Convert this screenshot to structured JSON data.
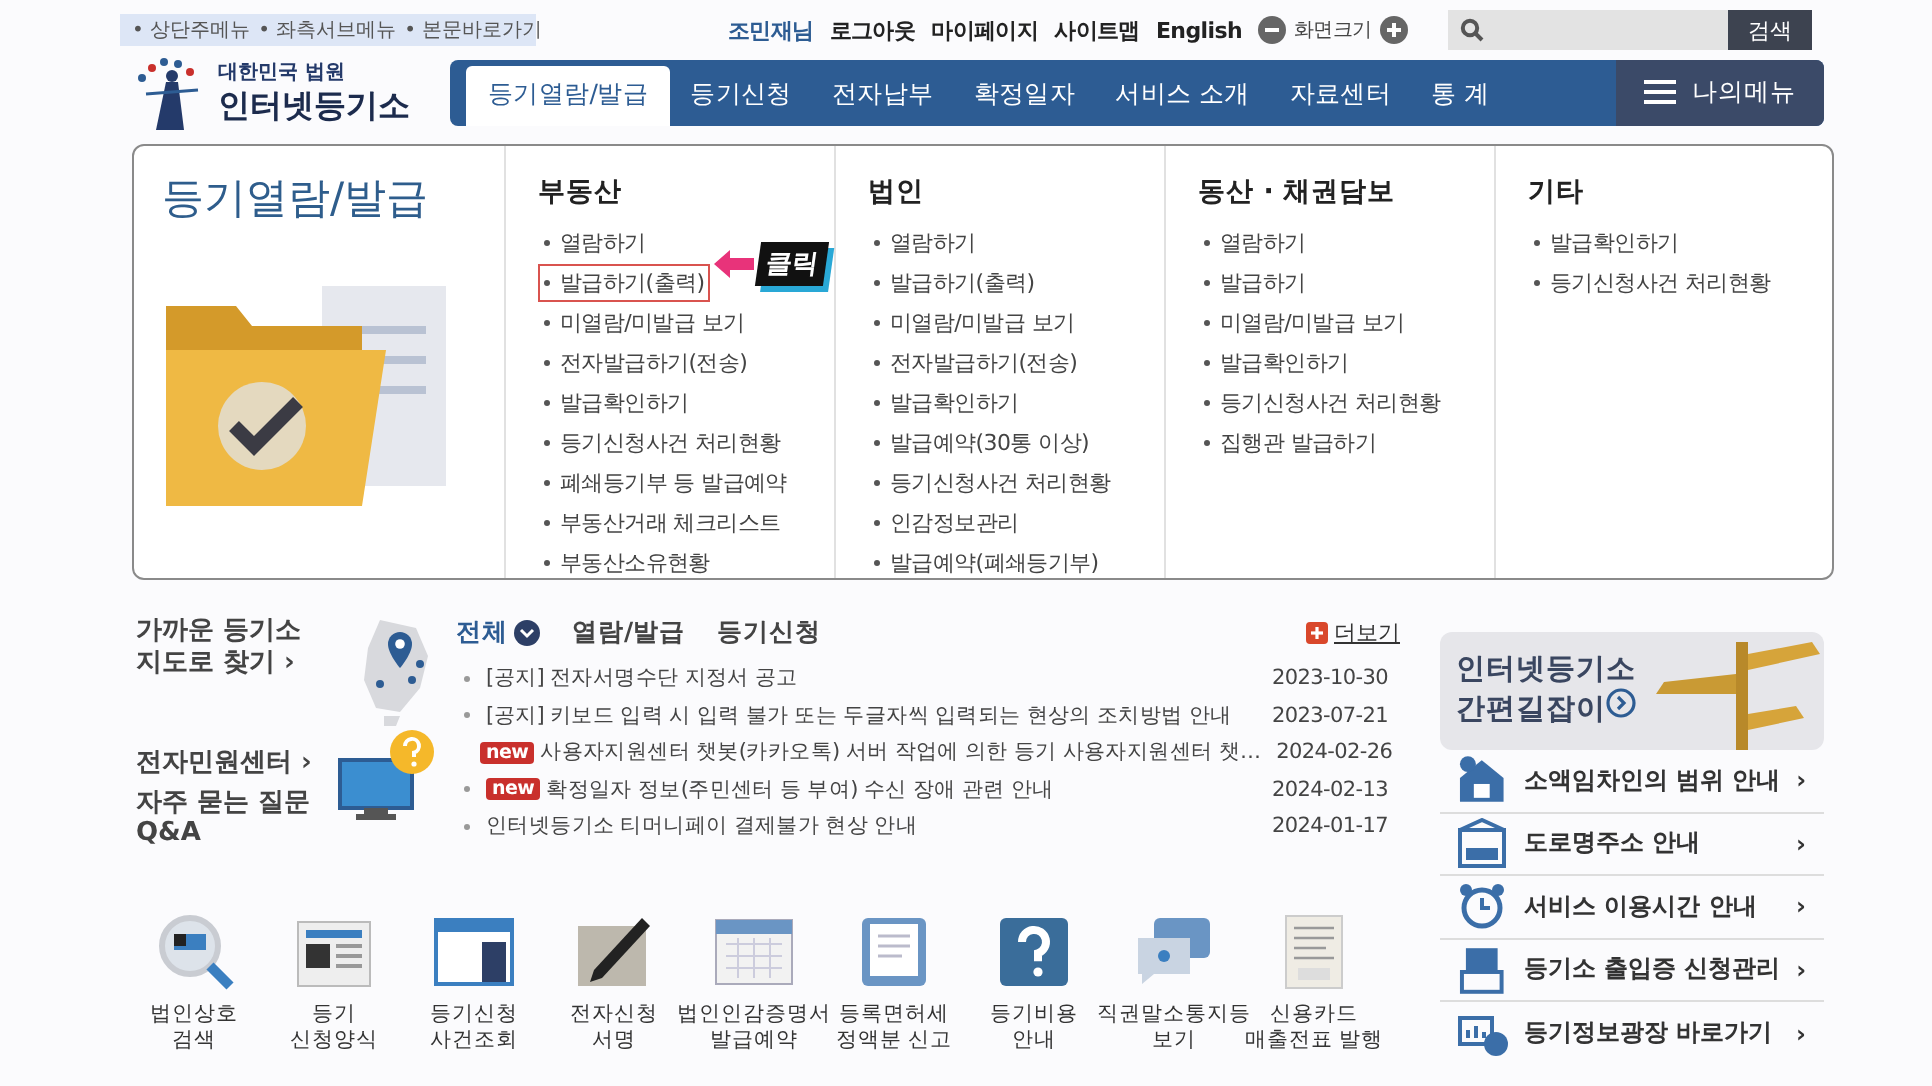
{
  "skip_links": [
    "• 상단주메뉴",
    "• 좌측서브메뉴",
    "• 본문바로가기"
  ],
  "utility_links": [
    {
      "text": "조민재님",
      "kind": "user"
    },
    {
      "text": "로그아웃",
      "kind": "link"
    },
    {
      "text": "마이페이지",
      "kind": "link"
    },
    {
      "text": "사이트맵",
      "kind": "link"
    },
    {
      "text": "English",
      "kind": "link"
    }
  ],
  "font_size": {
    "label": "화면크기"
  },
  "search": {
    "button": "검색"
  },
  "logo": {
    "line1": "대한민국 법원",
    "line2": "인터넷등기소"
  },
  "nav": {
    "tabs": [
      {
        "label": "등기열람/발급",
        "selected": true
      },
      {
        "label": "등기신청",
        "selected": false
      },
      {
        "label": "전자납부",
        "selected": false
      },
      {
        "label": "확정일자",
        "selected": false
      },
      {
        "label": "서비스 소개",
        "selected": false
      },
      {
        "label": "자료센터",
        "selected": false
      },
      {
        "label": "통 계",
        "selected": false
      }
    ],
    "my_menu": "나의메뉴"
  },
  "mega_menu": {
    "title": "등기열람/발급",
    "callout": "클릭",
    "columns": [
      {
        "heading": "부동산",
        "items": [
          {
            "label": "열람하기",
            "highlighted": false
          },
          {
            "label": "발급하기(출력)",
            "highlighted": true
          },
          {
            "label": "미열람/미발급 보기",
            "highlighted": false
          },
          {
            "label": "전자발급하기(전송)",
            "highlighted": false
          },
          {
            "label": "발급확인하기",
            "highlighted": false
          },
          {
            "label": "등기신청사건 처리현황",
            "highlighted": false
          },
          {
            "label": "폐쇄등기부 등 발급예약",
            "highlighted": false
          },
          {
            "label": "부동산거래 체크리스트",
            "highlighted": false
          },
          {
            "label": "부동산소유현황",
            "highlighted": false
          }
        ]
      },
      {
        "heading": "법인",
        "items": [
          {
            "label": "열람하기",
            "highlighted": false
          },
          {
            "label": "발급하기(출력)",
            "highlighted": false
          },
          {
            "label": "미열람/미발급 보기",
            "highlighted": false
          },
          {
            "label": "전자발급하기(전송)",
            "highlighted": false
          },
          {
            "label": "발급확인하기",
            "highlighted": false
          },
          {
            "label": "발급예약(30통 이상)",
            "highlighted": false
          },
          {
            "label": "등기신청사건 처리현황",
            "highlighted": false
          },
          {
            "label": "인감정보관리",
            "highlighted": false
          },
          {
            "label": "발급예약(폐쇄등기부)",
            "highlighted": false
          }
        ]
      },
      {
        "heading": "동산 · 채권담보",
        "items": [
          {
            "label": "열람하기",
            "highlighted": false
          },
          {
            "label": "발급하기",
            "highlighted": false
          },
          {
            "label": "미열람/미발급 보기",
            "highlighted": false
          },
          {
            "label": "발급확인하기",
            "highlighted": false
          },
          {
            "label": "등기신청사건 처리현황",
            "highlighted": false
          },
          {
            "label": "집행관 발급하기",
            "highlighted": false
          }
        ]
      },
      {
        "heading": "기타",
        "items": [
          {
            "label": "발급확인하기",
            "highlighted": false
          },
          {
            "label": "등기신청사건 처리현황",
            "highlighted": false
          }
        ]
      }
    ]
  },
  "side_left": {
    "map_link": [
      "가까운 등기소",
      "지도로 찾기 ›"
    ],
    "ecivil_link": "전자민원센터 ›",
    "faq": [
      "자주 묻는 질문",
      "Q&A"
    ]
  },
  "notice": {
    "tabs": [
      {
        "label": "전체",
        "selected": true
      },
      {
        "label": "열람/발급",
        "selected": false
      },
      {
        "label": "등기신청",
        "selected": false
      }
    ],
    "more": "더보기",
    "rows": [
      {
        "title": "[공지] 전자서명수단 지정서 공고",
        "date": "2023-10-30"
      },
      {
        "title": "[공지] 키보드 입력 시 입력 불가 또는 두글자씩 입력되는 현상의 조치방법 안내",
        "date": "2023-07-21"
      },
      {
        "badge": "new",
        "title": "사용자지원센터 챗봇(카카오톡) 서버 작업에 의한 등기 사용자지원센터 챗…",
        "date": "2024-02-26"
      },
      {
        "badge": "new",
        "title": "확정일자 정보(주민센터 등 부여) 수신 장애 관련 안내",
        "date": "2024-02-13"
      },
      {
        "title": "인터넷등기소 티머니페이 결제불가 현상 안내",
        "date": "2024-01-17"
      }
    ]
  },
  "quick_links": [
    {
      "lines": [
        "법인상호",
        "검색"
      ]
    },
    {
      "lines": [
        "등기",
        "신청양식"
      ]
    },
    {
      "lines": [
        "등기신청",
        "사건조회"
      ]
    },
    {
      "lines": [
        "전자신청",
        "서명"
      ]
    },
    {
      "lines": [
        "법인인감증명서",
        "발급예약"
      ]
    },
    {
      "lines": [
        "등록면허세",
        "정액분 신고"
      ]
    },
    {
      "lines": [
        "등기비용",
        "안내"
      ]
    },
    {
      "lines": [
        "직권말소통지등",
        "보기"
      ]
    },
    {
      "lines": [
        "신용카드",
        "매출전표 발행"
      ]
    }
  ],
  "guide_banner": [
    "인터넷등기소",
    "간편길잡이"
  ],
  "side_links": [
    {
      "label": "소액임차인의 범위 안내",
      "arrow": "›"
    },
    {
      "label": "도로명주소 안내",
      "arrow": "›"
    },
    {
      "label": "서비스 이용시간 안내",
      "arrow": "›"
    },
    {
      "label": "등기소 출입증 신청관리",
      "arrow": "›"
    },
    {
      "label": "등기정보광장 바로가기",
      "arrow": "›"
    }
  ]
}
